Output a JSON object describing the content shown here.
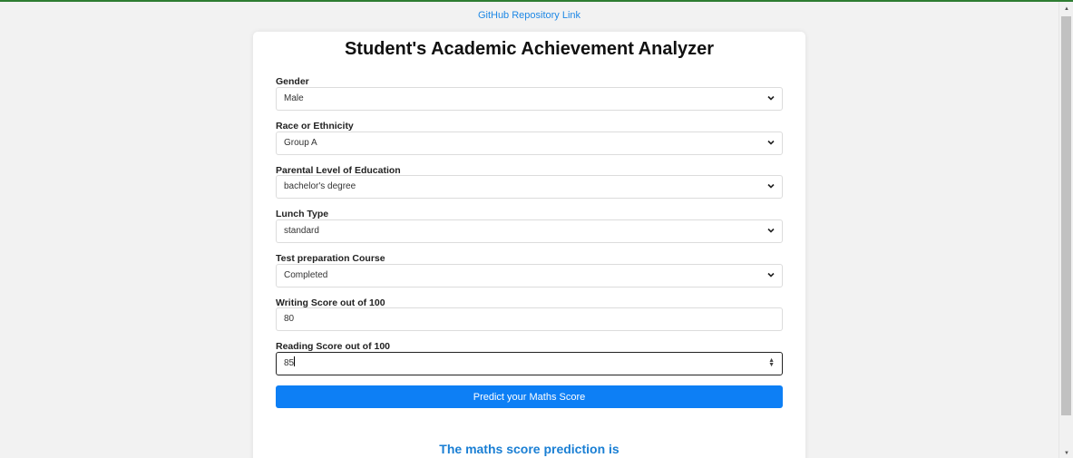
{
  "header": {
    "repo_link_label": "GitHub Repository Link"
  },
  "form": {
    "title": "Student's Academic Achievement Analyzer",
    "gender": {
      "label": "Gender",
      "value": "Male"
    },
    "race": {
      "label": "Race or Ethnicity",
      "value": "Group A"
    },
    "parental_education": {
      "label": "Parental Level of Education",
      "value": "bachelor's degree"
    },
    "lunch": {
      "label": "Lunch Type",
      "value": "standard"
    },
    "test_prep": {
      "label": "Test preparation Course",
      "value": "Completed"
    },
    "writing_score": {
      "label": "Writing Score out of 100",
      "value": "80"
    },
    "reading_score": {
      "label": "Reading Score out of 100",
      "value": "85"
    },
    "submit_label": "Predict your Maths Score"
  },
  "result": {
    "heading": "The maths score prediction is"
  },
  "icons": {
    "select_arrow": "chevron-down-icon",
    "number_spinner": "spinner-icon"
  },
  "colors": {
    "accent": "#0d7ff5",
    "result_text": "#1a7fd4",
    "link": "#1e88e5"
  }
}
